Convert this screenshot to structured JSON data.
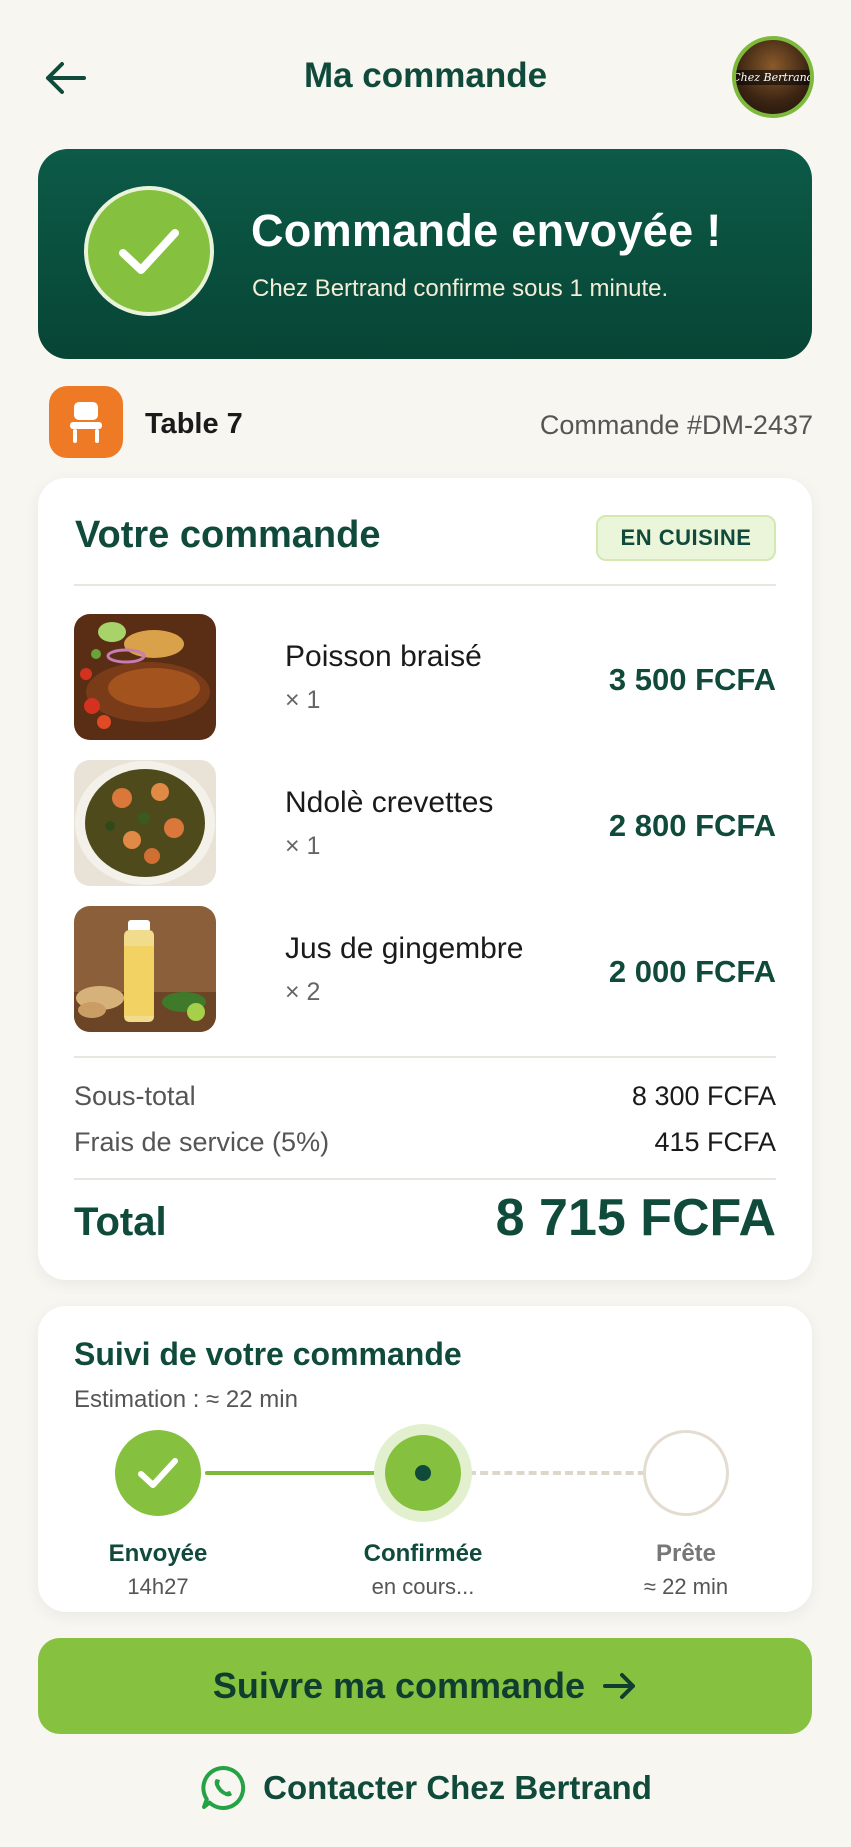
{
  "header": {
    "title": "Ma commande",
    "restaurant_logo_text": "Chez Bertrand"
  },
  "banner": {
    "title": "Commande envoyée !",
    "subtitle": "Chez Bertrand confirme sous 1 minute."
  },
  "meta": {
    "table": "Table 7",
    "order_number": "Commande #DM-2437"
  },
  "order": {
    "title": "Votre commande",
    "status": "EN CUISINE",
    "items": [
      {
        "name": "Poisson braisé",
        "qty": "× 1",
        "price": "3 500 FCFA",
        "image": "grilled-fish"
      },
      {
        "name": "Ndolè crevettes",
        "qty": "× 1",
        "price": "2 800 FCFA",
        "image": "ndole-shrimp"
      },
      {
        "name": "Jus de gingembre",
        "qty": "× 2",
        "price": "2 000 FCFA",
        "image": "ginger-juice"
      }
    ],
    "subtotal_label": "Sous-total",
    "subtotal_value": "8 300 FCFA",
    "fee_label": "Frais de service (5%)",
    "fee_value": "415 FCFA",
    "total_label": "Total",
    "total_value": "8 715 FCFA"
  },
  "tracking": {
    "title": "Suivi de votre commande",
    "estimate": "Estimation : ≈ 22 min",
    "steps": [
      {
        "label": "Envoyée",
        "sub": "14h27",
        "state": "done"
      },
      {
        "label": "Confirmée",
        "sub": "en cours...",
        "state": "current"
      },
      {
        "label": "Prête",
        "sub": "≈ 22 min",
        "state": "pending"
      }
    ]
  },
  "actions": {
    "track_label": "Suivre ma commande",
    "contact_label": "Contacter Chez Bertrand"
  },
  "colors": {
    "primary_dark": "#0f4a3b",
    "accent_green": "#86c23f",
    "accent_orange": "#ef7a26",
    "background": "#f8f6f1"
  },
  "icons": {
    "back": "arrow-left-icon",
    "check": "checkmark-icon",
    "chair": "chair-icon",
    "arrow": "arrow-right-icon",
    "whatsapp": "whatsapp-icon"
  }
}
